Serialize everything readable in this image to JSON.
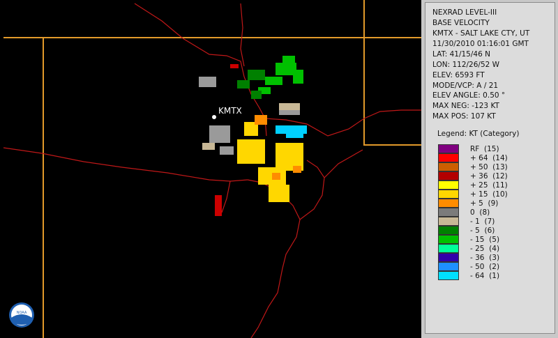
{
  "info": {
    "product": "NEXRAD LEVEL-III",
    "type": "BASE VELOCITY",
    "station": "KMTX - SALT LAKE CTY, UT",
    "datetime": "11/30/2010 01:16:01 GMT",
    "lat": "LAT: 41/15/46 N",
    "lon": "LON: 112/26/52 W",
    "elev": "ELEV: 6593 FT",
    "mode": "MODE/VCP: A / 21",
    "elev_angle": "ELEV ANGLE: 0.50 °",
    "max_neg": "MAX NEG: -123 KT",
    "max_pos": "MAX POS: 107 KT"
  },
  "map": {
    "station_label": "KMTX"
  },
  "legend": {
    "title": "Legend: KT (Category)",
    "items": [
      {
        "label": "RF  (15)",
        "color": "#800080"
      },
      {
        "label": "+ 64  (14)",
        "color": "#ff0000"
      },
      {
        "label": "+ 50  (13)",
        "color": "#cd5f00"
      },
      {
        "label": "+ 36  (12)",
        "color": "#b30000"
      },
      {
        "label": "+ 25  (11)",
        "color": "#ffff00"
      },
      {
        "label": "+ 15  (10)",
        "color": "#ffd700"
      },
      {
        "label": "+ 5  (9)",
        "color": "#ff8c00"
      },
      {
        "label": "0  (8)",
        "color": "#7b7b7b"
      },
      {
        "label": "- 1  (7)",
        "color": "#c8b896"
      },
      {
        "label": "- 5  (6)",
        "color": "#008000"
      },
      {
        "label": "- 15  (5)",
        "color": "#00c000"
      },
      {
        "label": "- 25  (4)",
        "color": "#00ff99"
      },
      {
        "label": "- 36  (3)",
        "color": "#3300aa"
      },
      {
        "label": "- 50  (2)",
        "color": "#1e90ff"
      },
      {
        "label": "- 64  (1)",
        "color": "#00e0ff"
      }
    ]
  },
  "colors": {
    "state_border": "#e39a2a",
    "county_border": "#b01818",
    "background": "#000000",
    "panel": "#dcdcdc"
  }
}
